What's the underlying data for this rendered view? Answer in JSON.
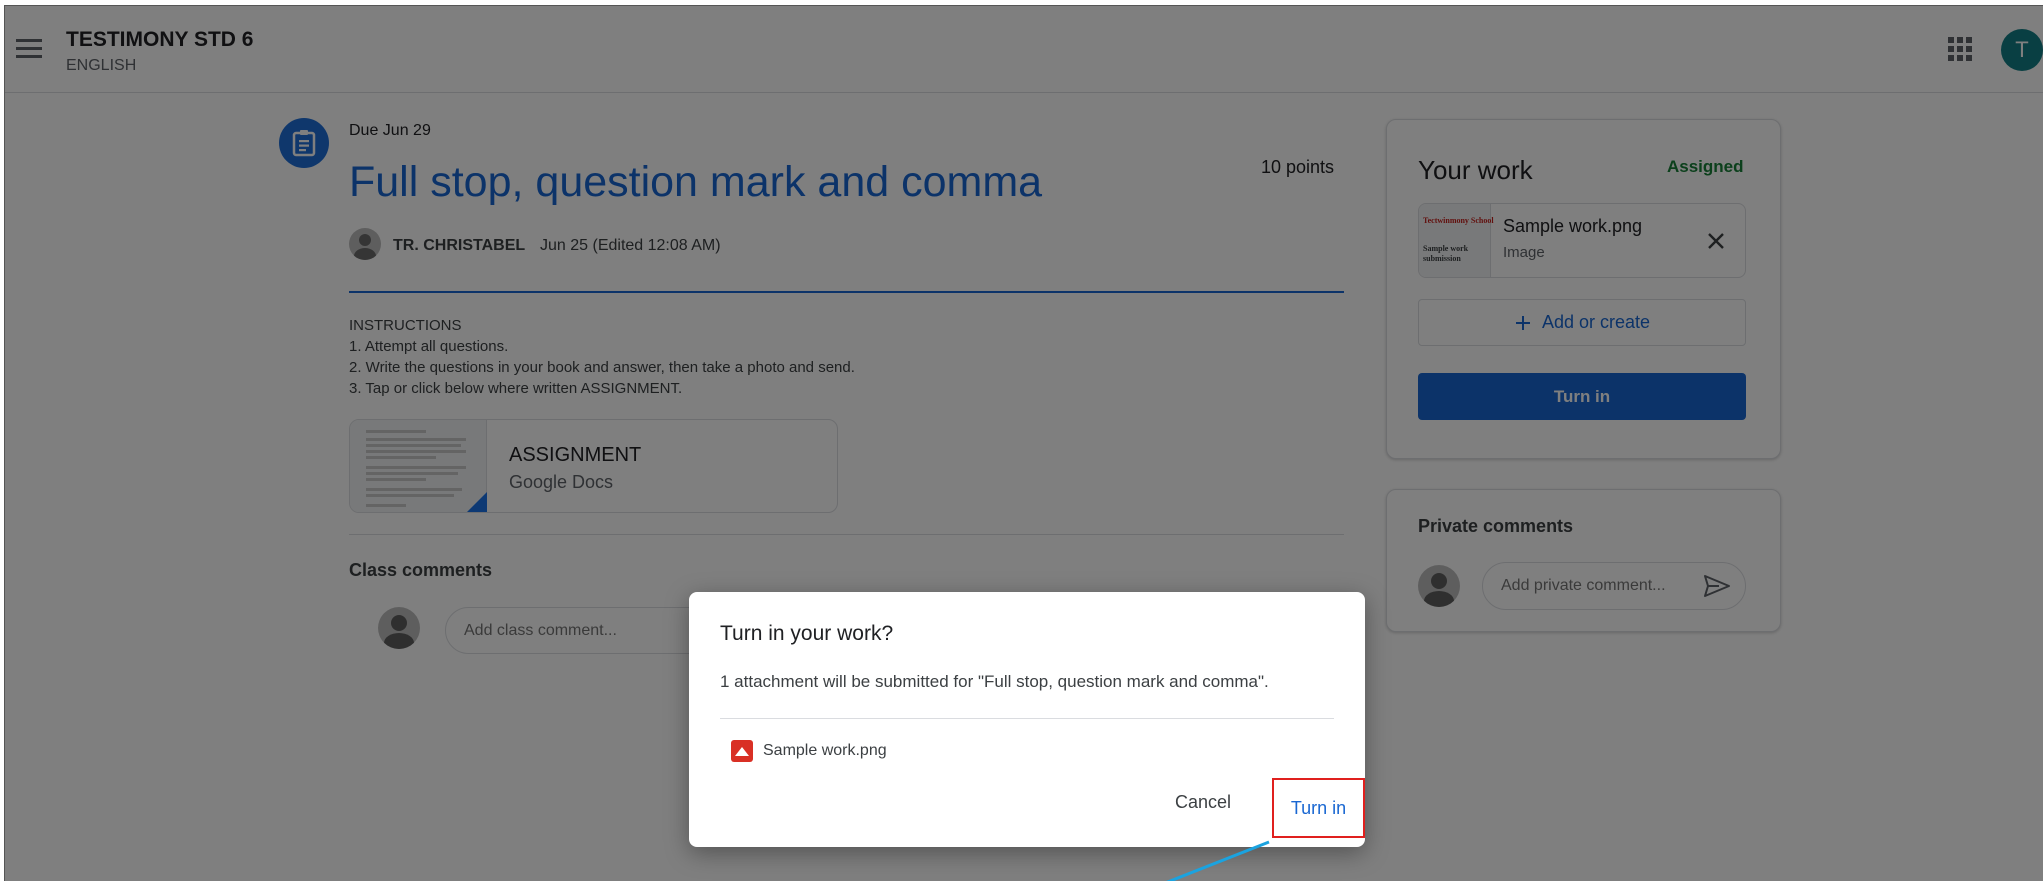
{
  "header": {
    "class_name": "TESTIMONY STD 6",
    "subject": "ENGLISH",
    "avatar_letter": "T"
  },
  "assignment": {
    "due": "Due Jun 29",
    "title": "Full stop, question mark and comma",
    "points": "10 points",
    "teacher": "TR. CHRISTABEL",
    "posted": "Jun 25 (Edited 12:08 AM)",
    "instructions": [
      "INSTRUCTIONS",
      "1. Attempt all questions.",
      "2. Write the questions in your book and answer, then take a photo and send.",
      "3. Tap or click below where written ASSIGNMENT."
    ],
    "attachment": {
      "name": "ASSIGNMENT",
      "type": "Google Docs"
    }
  },
  "class_comments": {
    "label": "Class comments",
    "placeholder": "Add class comment..."
  },
  "your_work": {
    "title": "Your work",
    "status": "Assigned",
    "file": {
      "name": "Sample work.png",
      "type": "Image",
      "thumb_title": "Tectwinmony School",
      "thumb_line1": "Sample work",
      "thumb_line2": "submission"
    },
    "add_create": "Add or create",
    "turn_in": "Turn in"
  },
  "private_comments": {
    "title": "Private comments",
    "placeholder": "Add private comment..."
  },
  "dialog": {
    "title": "Turn in your work?",
    "message": "1 attachment will be submitted for \"Full stop, question mark and comma\".",
    "file_name": "Sample work.png",
    "cancel": "Cancel",
    "turn_in": "Turn in"
  },
  "colors": {
    "accent": "#1967d2",
    "status_green": "#188038",
    "highlight_red": "#e0201e",
    "avatar_teal": "#137f86"
  }
}
